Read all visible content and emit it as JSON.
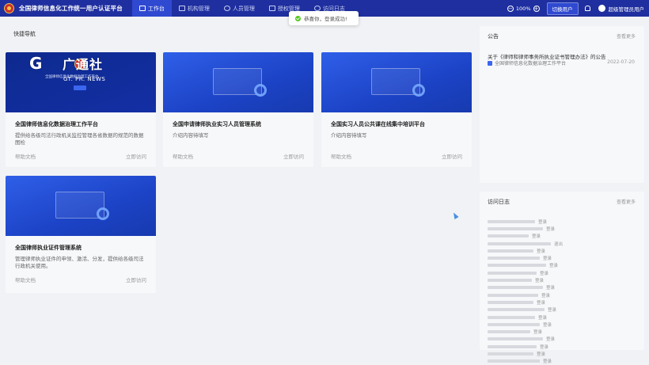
{
  "header": {
    "app_title": "全国律师信息化工作统一用户认证平台",
    "nav": [
      {
        "label": "工作台",
        "active": true,
        "icon": "monitor-icon"
      },
      {
        "label": "机构管理",
        "active": false,
        "icon": "building-icon"
      },
      {
        "label": "人员管理",
        "active": false,
        "icon": "user-icon"
      },
      {
        "label": "授权管理",
        "active": false,
        "icon": "shield-icon"
      },
      {
        "label": "访问日志",
        "active": false,
        "icon": "clock-icon"
      }
    ],
    "zoom": "100%",
    "zoom_out": "−",
    "zoom_in": "+",
    "switch_user": "切换用户",
    "user": "超级管理员用户"
  },
  "toast": {
    "message": "恭喜你，登录成功!"
  },
  "watermark": {
    "brand": "广通社",
    "logo": "G",
    "sub": "GT. PR. NEWS"
  },
  "quick": {
    "title": "快捷导航",
    "cards": [
      {
        "name": "全国律师信息化数据治理工作平台",
        "desc": "提供给各级司法行政机关监控管理各省数据的规范的数据图检",
        "help": "帮助文档",
        "visit": "立即访问",
        "banner_title": "全国律师信息化数据治理工作平台"
      },
      {
        "name": "全国申请律师执业实习人员管理系统",
        "desc": "介绍内容待填写",
        "help": "帮助文档",
        "visit": "立即访问"
      },
      {
        "name": "全国实习人员公共课在线集中培训平台",
        "desc": "介绍内容待填写",
        "help": "帮助文档",
        "visit": "立即访问"
      },
      {
        "name": "全国律师执业证件管理系统",
        "desc": "管理律师执业证件的申领、激活、分发，提供给各级司法行政机关使用。",
        "help": "帮助文档",
        "visit": "立即访问"
      }
    ]
  },
  "notice": {
    "title": "公告",
    "more": "查看更多",
    "items": [
      {
        "title": "关于《律师和律师事务所执业证书管理办法》的公告",
        "source": "全国律师信息化数据治理工作平台",
        "date": "2022-07-20"
      }
    ]
  },
  "logs": {
    "title": "访问日志",
    "more": "查看更多",
    "rows": [
      {
        "action": "登录"
      },
      {
        "action": "登录"
      },
      {
        "action": "登录"
      },
      {
        "action": "退出"
      },
      {
        "action": "登录"
      },
      {
        "action": "登录"
      },
      {
        "action": "登录"
      },
      {
        "action": "登录"
      },
      {
        "action": "登录"
      },
      {
        "action": "登录"
      },
      {
        "action": "登录"
      },
      {
        "action": "登录"
      },
      {
        "action": "登录"
      },
      {
        "action": "登录"
      },
      {
        "action": "登录"
      },
      {
        "action": "登录"
      },
      {
        "action": "登录"
      },
      {
        "action": "登录"
      },
      {
        "action": "登录"
      },
      {
        "action": "登录"
      }
    ]
  }
}
